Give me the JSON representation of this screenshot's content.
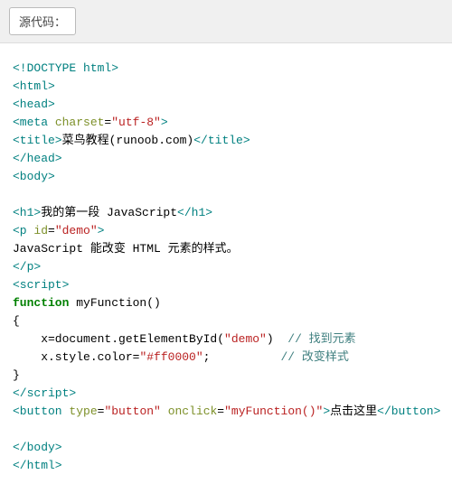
{
  "toolbar": {
    "source_label": "源代码："
  },
  "code": {
    "doctype": "<!DOCTYPE html>",
    "html_o": "<html>",
    "html_c": "</html>",
    "head_o": "<head>",
    "head_c": "</head>",
    "meta": {
      "tag_o": "<meta ",
      "attr": "charset",
      "eq": "=",
      "val": "\"utf-8\"",
      "tag_c": ">"
    },
    "title": {
      "o": "<title>",
      "text": "菜鸟教程(runoob.com)",
      "c": "</title>"
    },
    "body_o": "<body>",
    "body_c": "</body>",
    "h1": {
      "o": "<h1>",
      "text": "我的第一段 JavaScript",
      "c": "</h1>"
    },
    "p": {
      "o": "<p ",
      "attr": "id",
      "eq": "=",
      "val": "\"demo\"",
      "cl": ">",
      "c": "</p>"
    },
    "p_text": "JavaScript 能改变 HTML 元素的样式。",
    "script_o": "<script>",
    "script_c": "</script>",
    "fn_kw": "function",
    "fn_name": " myFunction()",
    "brace_o": "{",
    "brace_c": "}",
    "line1a": "    x=document.getElementById(",
    "line1b": "\"demo\"",
    "line1c": ")  ",
    "com1": "// 找到元素",
    "line2a": "    x.style.color=",
    "line2b": "\"#ff0000\"",
    "line2c": ";          ",
    "com2": "// 改变样式",
    "btn": {
      "o": "<button ",
      "a1": "type",
      "v1": "\"button\"",
      "a2": "onclick",
      "v2": "\"myFunction()\"",
      "cl": ">",
      "text": "点击这里",
      "c": "</button>"
    }
  }
}
